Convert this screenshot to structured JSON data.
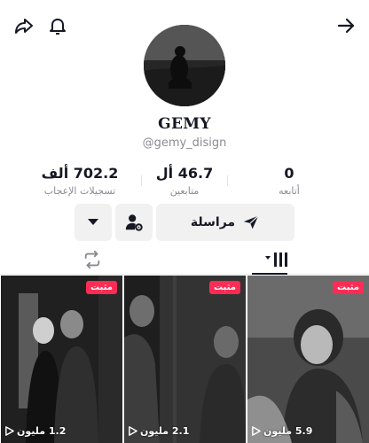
{
  "profile": {
    "username": "GEMY",
    "handle": "@gemy_disign"
  },
  "stats": [
    {
      "value": "0",
      "label": "أتابعه"
    },
    {
      "value": "46.7 أل",
      "label": "متابعين"
    },
    {
      "value": "702.2 ألف",
      "label": "تسجيلات الإعجاب"
    }
  ],
  "actions": {
    "message_label": "مراسلة"
  },
  "videos": [
    {
      "pinned_label": "مثبت",
      "views": "5.9 مليون"
    },
    {
      "pinned_label": "مثبت",
      "views": "2.1 مليون"
    },
    {
      "pinned_label": "مثبت",
      "views": "1.2 مليون"
    }
  ],
  "icons": {
    "share": "share-icon",
    "bell": "bell-icon",
    "forward": "arrow-right-icon",
    "message": "send-icon",
    "add_friend": "user-settings-icon",
    "more": "triangle-down-icon",
    "videos_tab": "grid-bars-icon",
    "reposts_tab": "repost-icon",
    "play": "play-icon"
  },
  "colors": {
    "pinned_badge": "#fe2c55",
    "secondary_text": "#8a8b91",
    "button_bg": "#f1f1f2"
  }
}
